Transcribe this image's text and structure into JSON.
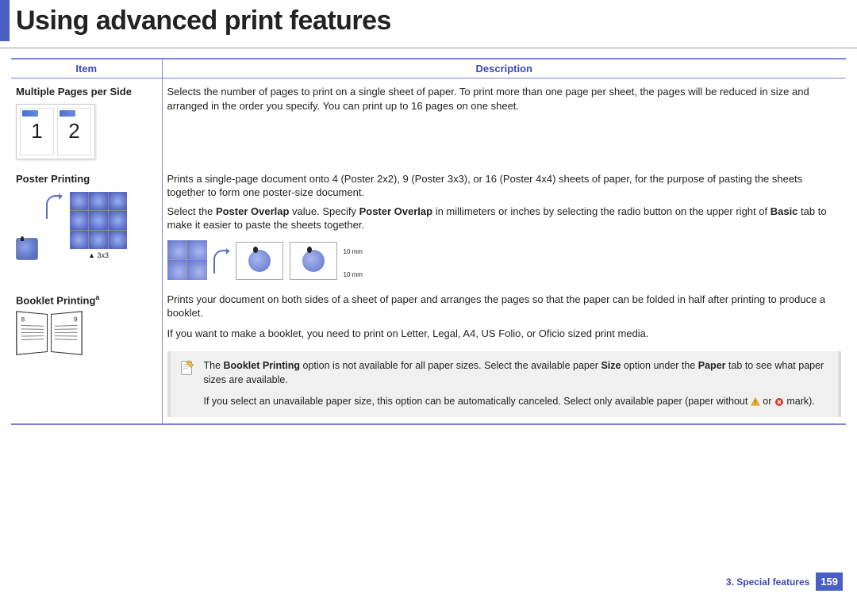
{
  "page_title": "Using advanced print features",
  "columns": {
    "item": "Item",
    "description": "Description"
  },
  "rows": {
    "multiple_pages": {
      "label": "Multiple Pages per Side",
      "desc": "Selects the number of pages to print on a single sheet of paper. To print more than one page per sheet, the pages will be reduced in size and arranged in the order you specify. You can print up to 16 pages on one sheet.",
      "thumb_numbers": [
        "1",
        "2"
      ]
    },
    "poster": {
      "label": "Poster Printing",
      "caption": "▲ 3x3",
      "desc_p1": "Prints a single-page document onto 4 (Poster 2x2), 9 (Poster 3x3), or 16 (Poster 4x4) sheets of paper, for the purpose of pasting the sheets together to form one poster-size document.",
      "desc_p2_a": "Select the ",
      "desc_p2_b": "Poster Overlap",
      "desc_p2_c": " value. Specify ",
      "desc_p2_d": "Poster Overlap",
      "desc_p2_e": " in millimeters or inches by selecting the radio button on the upper right of ",
      "desc_p2_f": "Basic",
      "desc_p2_g": " tab to make it easier to paste the sheets together.",
      "dim_top": "10 mm",
      "dim_bottom": "10 mm"
    },
    "booklet": {
      "label": "Booklet Printing",
      "sup": "a",
      "page_left_num": "8",
      "page_right_num": "9",
      "desc_p1": "Prints your document on both sides of a sheet of paper and arranges the pages so that the paper can be folded in half after printing to produce a booklet.",
      "desc_p2": "If you want to make a booklet, you need to print on Letter, Legal, A4, US Folio, or Oficio sized print media.",
      "note_p1_a": "The ",
      "note_p1_b": "Booklet Printing",
      "note_p1_c": " option is not available for all paper sizes. Select the available paper ",
      "note_p1_d": "Size",
      "note_p1_e": " option under the ",
      "note_p1_f": "Paper",
      "note_p1_g": " tab to see what paper sizes are available.",
      "note_p2_a": "If you select an unavailable paper size, this option can be automatically canceled. Select only available paper (paper without ",
      "note_p2_b": " or ",
      "note_p2_c": " mark)."
    }
  },
  "footer": {
    "chapter": "3.  Special features",
    "page": "159"
  }
}
